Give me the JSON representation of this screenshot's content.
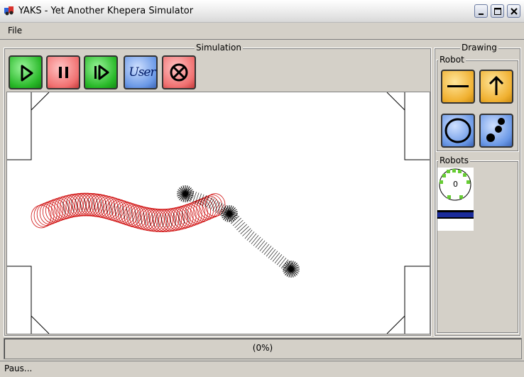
{
  "window": {
    "title": "YAKS - Yet Another Khepera Simulator"
  },
  "menu": {
    "file": "File"
  },
  "simulation": {
    "label": "Simulation",
    "buttons": [
      {
        "name": "play",
        "color": "#28b828"
      },
      {
        "name": "pause",
        "color": "#f07070"
      },
      {
        "name": "step",
        "color": "#28b828"
      },
      {
        "name": "user",
        "label": "User",
        "color": "#6a98e6"
      },
      {
        "name": "reset",
        "color": "#f07070"
      }
    ]
  },
  "drawing": {
    "label": "Drawing",
    "robot_group_label": "Robot",
    "robots_group_label": "Robots",
    "tools": [
      "line-tool",
      "arrow-tool",
      "circle-tool",
      "dots-tool"
    ],
    "robots": [
      {
        "id": "0",
        "status_color": "#66cc33"
      }
    ]
  },
  "progress": {
    "text": "(0%)",
    "value": 0
  },
  "status": {
    "text": "Paus..."
  },
  "colors": {
    "trail_red": "#d01010",
    "trail_black": "#000000"
  }
}
